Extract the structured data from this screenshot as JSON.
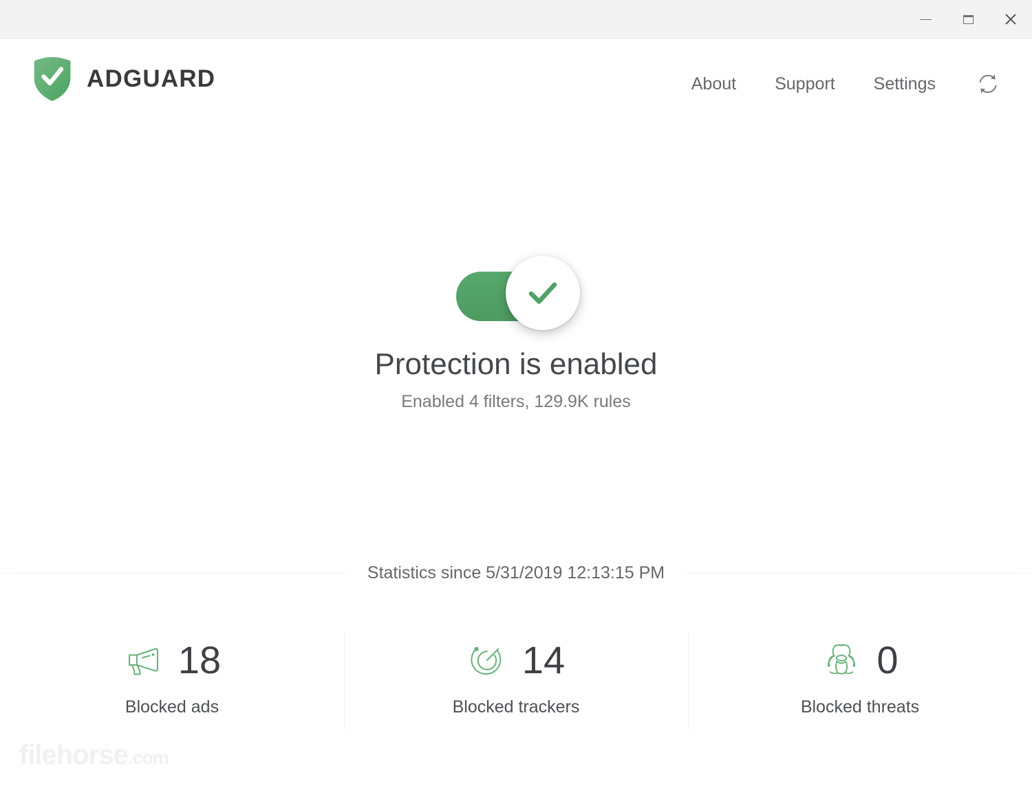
{
  "window": {
    "controls": [
      {
        "name": "minimize",
        "label": "–"
      },
      {
        "name": "maximize",
        "label": "❐"
      },
      {
        "name": "close",
        "label": "✕"
      }
    ],
    "close_glyph": "✕"
  },
  "brand": {
    "name": "ADGUARD",
    "logo_icon": "shield-check-icon",
    "logo_color": "#68b279"
  },
  "nav": {
    "items": [
      {
        "label": "About",
        "name": "about"
      },
      {
        "label": "Support",
        "name": "support"
      },
      {
        "label": "Settings",
        "name": "settings"
      }
    ],
    "refresh_icon": "refresh-sync-icon"
  },
  "protection": {
    "enabled": true,
    "toggle_icon": "checkmark-icon",
    "toggle_color": "#52a167",
    "title": "Protection is enabled",
    "subtitle": "Enabled 4 filters,  129.9K rules"
  },
  "statistics": {
    "since_label": "Statistics since 5/31/2019 12:13:15 PM",
    "accent_color": "#68b279",
    "cards": [
      {
        "icon": "megaphone-icon",
        "value": "18",
        "label": "Blocked ads"
      },
      {
        "icon": "radar-tracker-icon",
        "value": "14",
        "label": "Blocked trackers"
      },
      {
        "icon": "biohazard-icon",
        "value": "0",
        "label": "Blocked threats"
      }
    ]
  },
  "watermark": {
    "text": "filehorse",
    "suffix": ".com"
  }
}
